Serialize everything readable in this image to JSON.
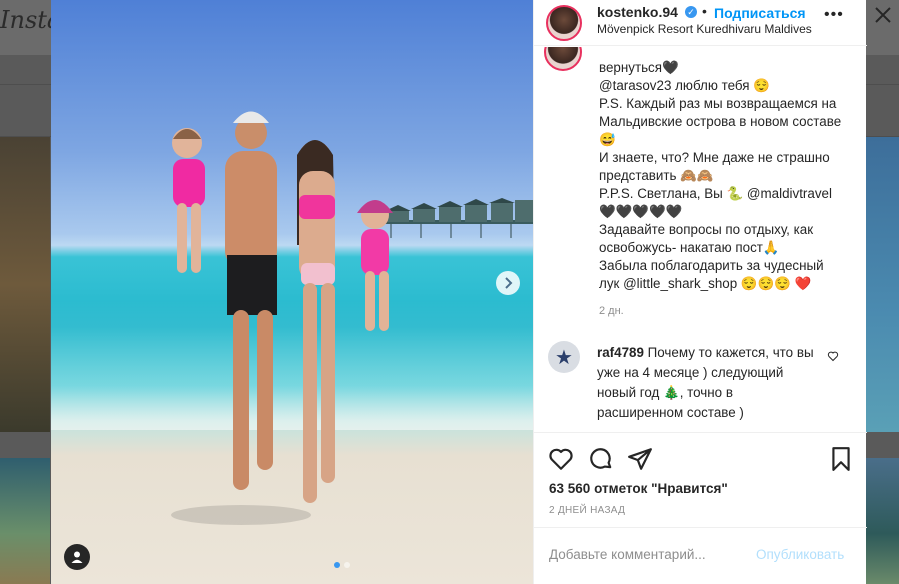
{
  "background": {
    "logo_text": "Insta"
  },
  "post": {
    "username": "kostenko.94",
    "bullet": "•",
    "follow_label": "Подписаться",
    "location": "Mövenpick Resort Kuredhivaru Maldives",
    "more_label": "•••",
    "caption": "вернуться🖤\n@tarasov23 люблю тебя 😌\nP.S. Каждый раз мы возвращаемся на Мальдивские острова в новом составе😅\nИ знаете, что? Мне даже не страшно представить 🙈🙈\nP.P.S. Светлана, Вы 🐍 @maldivtravel\n🖤🖤🖤🖤🖤\nЗадавайте вопросы по отдыху, как освобожусь- накатаю пост🙏\nЗабыла поблагодарить за чудесный лук @little_shark_shop 😌😌😌 ❤️",
    "caption_time": "2 дн.",
    "comment": {
      "username": "raf4789",
      "text": "Почему то кажется, что вы уже на 4 месяце ) следующий новый год 🎄, точно в расширенном составе )"
    },
    "likes": {
      "count": "63 560",
      "text": "отметок \"Нравится\""
    },
    "date": "2 ДНЕЙ НАЗАД",
    "comment_input_placeholder": "Добавьте комментарий...",
    "publish_label": "Опубликовать",
    "carousel": {
      "total_slides": 2,
      "current_slide": 1
    }
  },
  "colors": {
    "link_blue": "#0095f6",
    "publish_disabled": "#b2dffc",
    "muted": "#8e8e8e"
  },
  "icons": [
    "heart-icon",
    "comment-icon",
    "share-icon",
    "bookmark-icon",
    "verified-icon",
    "tag-user-icon",
    "chevron-right-icon",
    "close-icon"
  ]
}
